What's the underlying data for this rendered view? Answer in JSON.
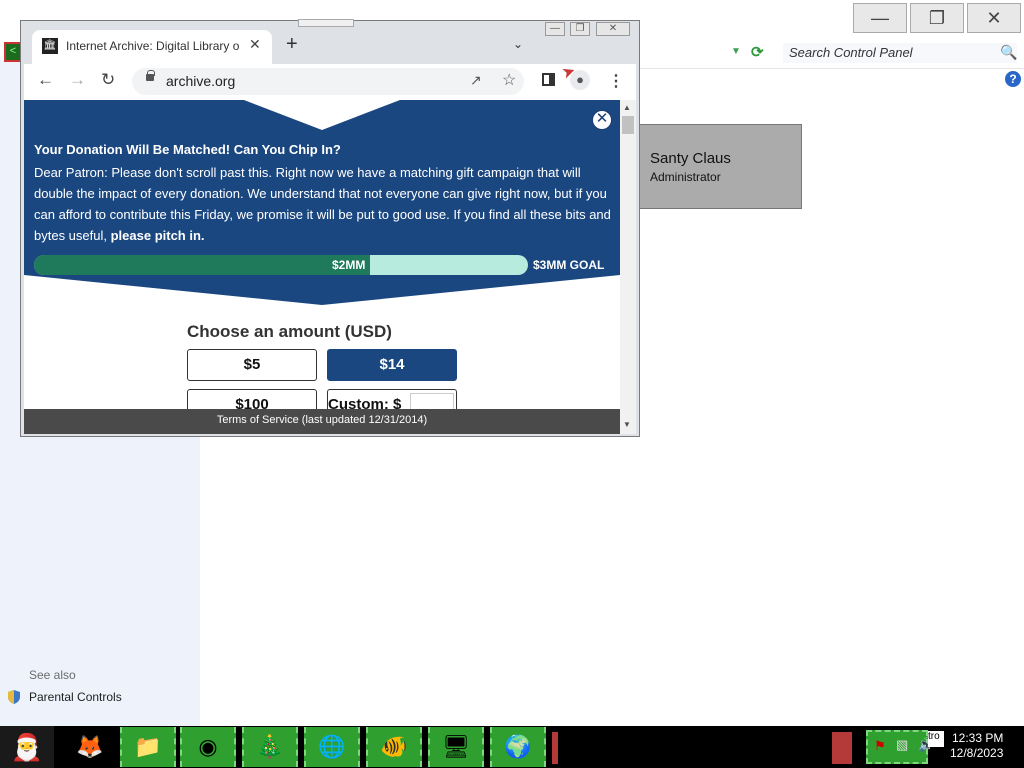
{
  "control_panel": {
    "search_placeholder": "Search Control Panel",
    "user": {
      "name": "Santy Claus",
      "role": "Administrator"
    },
    "see_also_label": "See also",
    "see_also_links": [
      "Parental Controls"
    ]
  },
  "chrome": {
    "tab_title": "Internet Archive: Digital Library o",
    "url": "archive.org"
  },
  "donation": {
    "heading": "Your Donation Will Be Matched! Can You Chip In?",
    "body_prefix": "Dear Patron: Please don't scroll past this. Right now we have a matching gift campaign that will double the impact of every donation. We understand that not everyone can give right now, but if you can afford to contribute this Friday, we promise it will be put to good use. If you find all these bits and bytes useful, ",
    "body_emphasis": "please pitch in.",
    "progress_fraction": 0.68,
    "progress_current_label": "$2MM",
    "progress_goal_label": "$3MM GOAL",
    "choose_label": "Choose an amount (USD)",
    "amounts": [
      "$5",
      "$14",
      "$100"
    ],
    "selected_amount": "$14",
    "custom_label": "Custom: $",
    "custom_value": "",
    "banner_color": "#1b4780",
    "progress_fill_color": "#1f7a5c",
    "progress_track_color": "#b6ebde"
  },
  "footer": {
    "terms": "Terms of Service (last updated 12/31/2014)"
  },
  "taskbar": {
    "items": [
      "santa-icon",
      "firefox-icon",
      "file-explorer-icon",
      "chrome-icon",
      "christmas-tree-icon",
      "globe-icon",
      "fish-icon",
      "control-panel-icon",
      "clock-globe-icon"
    ],
    "tray_partial_text": "tro",
    "time": "12:33 PM",
    "date": "12/8/2023"
  }
}
